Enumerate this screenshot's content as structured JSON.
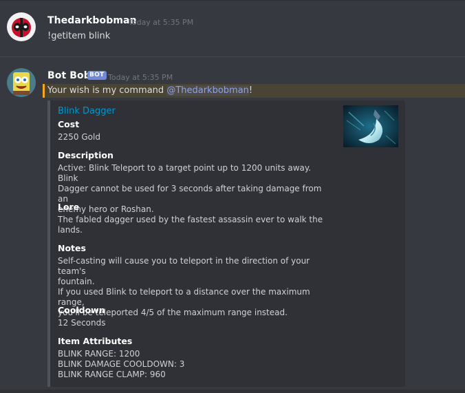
{
  "messages": [
    {
      "username": "Thedarkbobman",
      "timestamp": "Today at 5:35 PM",
      "text": "!getitem blink",
      "avatar_icon": "deadpool-avatar-icon"
    },
    {
      "username": "Bot Bob",
      "bot_tag": "BOT",
      "timestamp": "Today at 5:35 PM",
      "text_before": "Your wish is my command ",
      "mention": "@Thedarkbobman",
      "text_after": "!",
      "avatar_icon": "spongebob-avatar-icon"
    }
  ],
  "embed": {
    "title": "Blink Dagger",
    "thumbnail_icon": "blink-dagger-icon",
    "fields": [
      {
        "name": "Cost",
        "value": "2250 Gold"
      },
      {
        "name": "Description",
        "value": "Active: Blink Teleport to a target point up to 1200 units away. Blink\nDagger cannot be used for 3 seconds after taking damage from an\nenemy hero or Roshan."
      },
      {
        "name": "Lore",
        "value": "The fabled dagger used by the fastest assassin ever to walk the\nlands."
      },
      {
        "name": "Notes",
        "value": "Self-casting will cause you to teleport in the direction of your team's\nfountain.\nIf you used Blink to teleport to a distance over the maximum range,\nyou'll be teleported 4/5 of the maximum range instead."
      },
      {
        "name": "Cooldown",
        "value": "12 Seconds"
      },
      {
        "name": "Item Attributes",
        "value": "BLINK RANGE: 1200\nBLINK DAMAGE COOLDOWN: 3\nBLINK RANGE CLAMP: 960"
      }
    ]
  },
  "colors": {
    "background": "#36393f",
    "embed_background": "#2f3136",
    "link": "#0096cf",
    "mention": "#8fa2e6",
    "mention_highlight_border": "#faa61a",
    "bot_tag": "#7289da"
  }
}
